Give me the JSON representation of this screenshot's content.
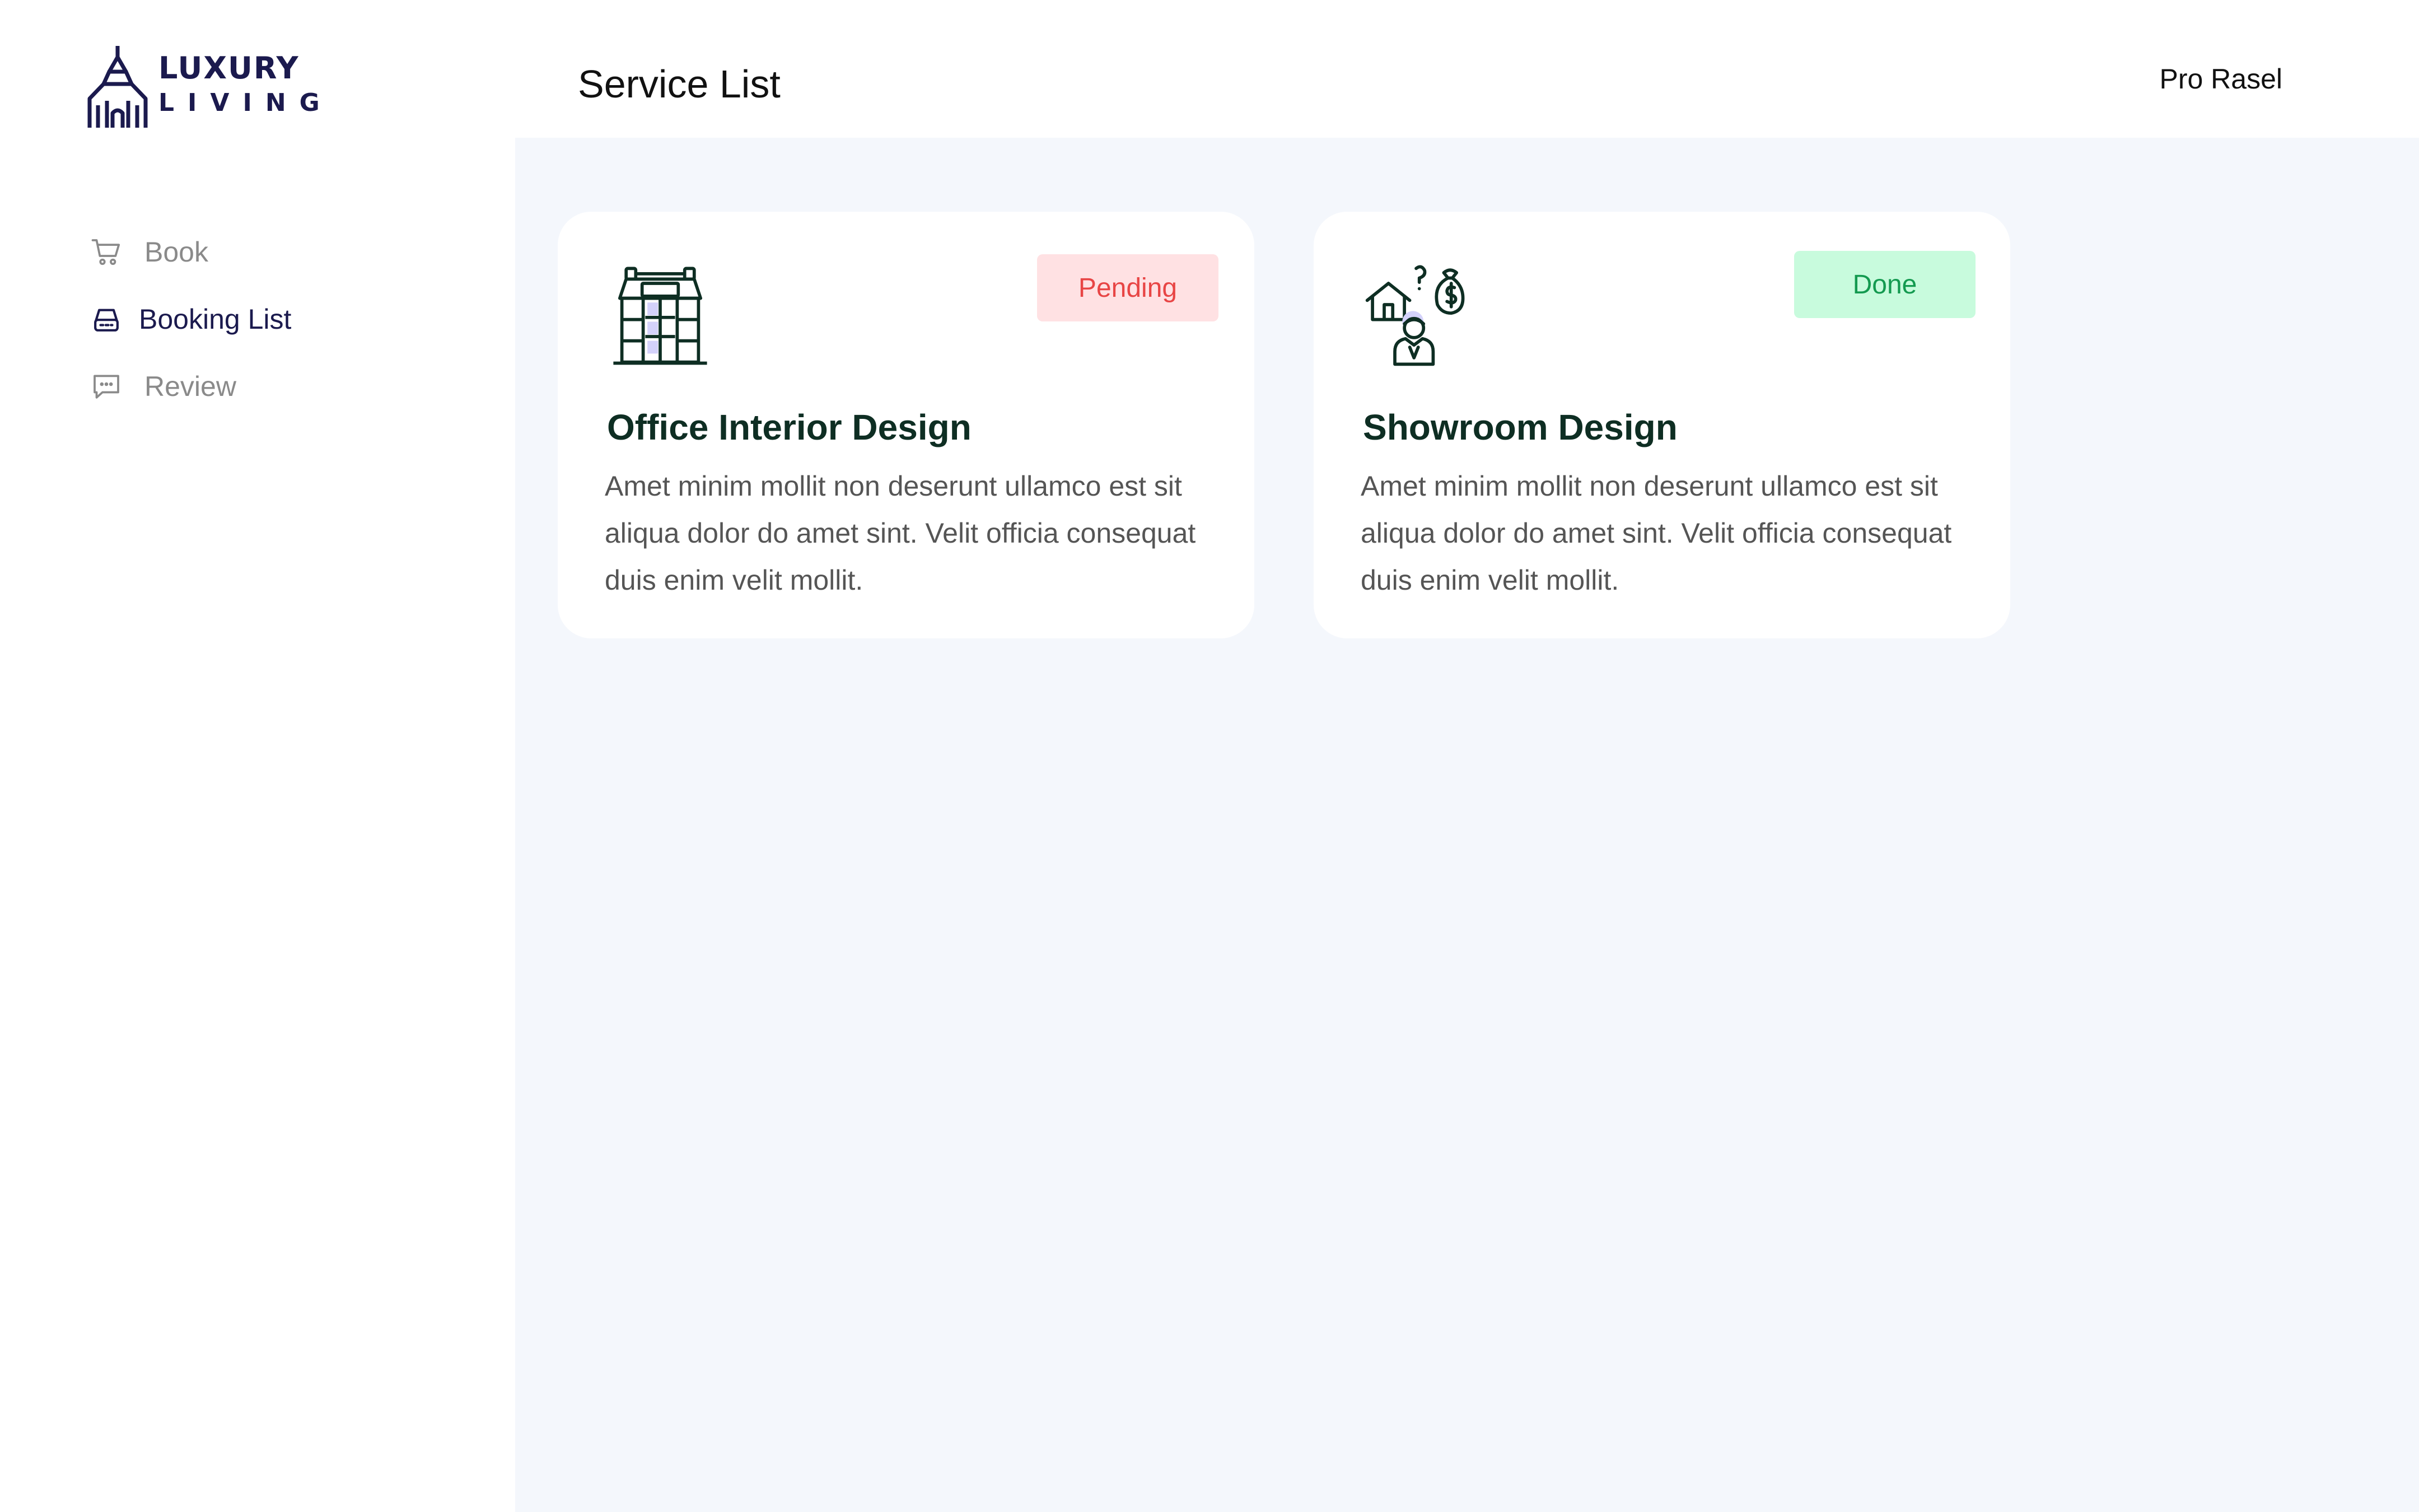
{
  "brand": {
    "line1": "LUXURY",
    "line2": "LIVING",
    "color": "#1b1a4e"
  },
  "sidebar": {
    "items": [
      {
        "label": "Book",
        "icon": "cart-icon",
        "active": false
      },
      {
        "label": "Booking List",
        "icon": "inbox-icon",
        "active": true
      },
      {
        "label": "Review",
        "icon": "chat-icon",
        "active": false
      }
    ]
  },
  "header": {
    "title": "Service List",
    "user": "Pro Rasel"
  },
  "services": [
    {
      "title": "Office Interior Design",
      "description": "Amet minim mollit non deserunt ullamco est sit aliqua dolor do amet sint. Velit officia consequat duis enim velit mollit.",
      "status": "Pending",
      "icon": "office-building-icon"
    },
    {
      "title": "Showroom Design",
      "description": "Amet minim mollit non deserunt ullamco est sit aliqua dolor do amet sint. Velit officia consequat duis enim velit mollit.",
      "status": "Done",
      "icon": "house-money-person-icon"
    }
  ],
  "colors": {
    "pending_bg": "#ffe1e3",
    "pending_text": "#e84545",
    "done_bg": "#c8fbdd",
    "done_text": "#149a50",
    "main_bg": "#f4f7fc",
    "title_text": "#0e2e23"
  }
}
